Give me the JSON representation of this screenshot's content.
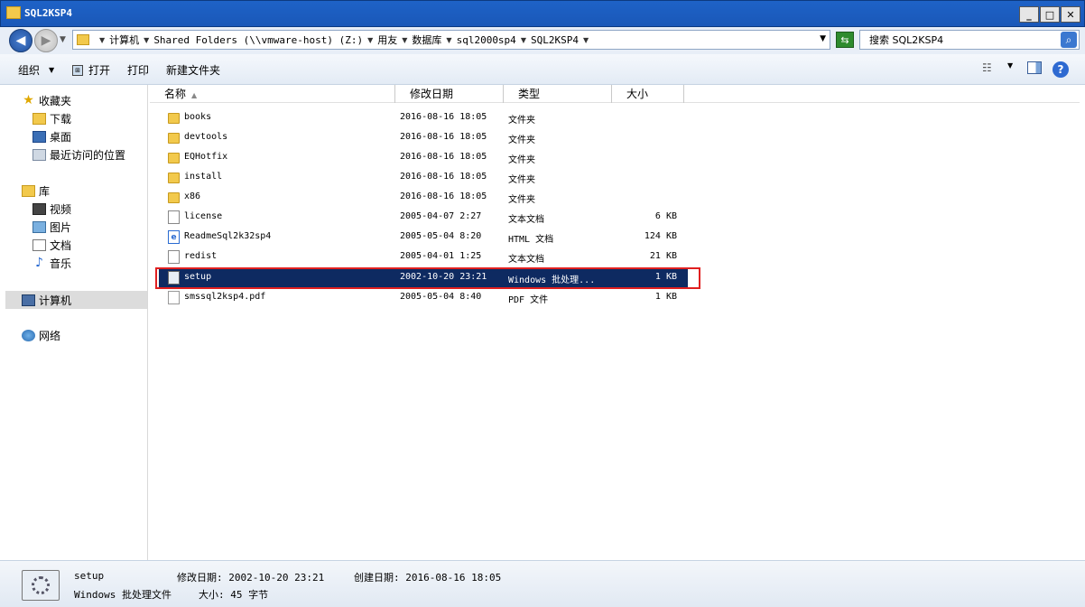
{
  "window": {
    "title": "SQL2KSP4"
  },
  "window_buttons": {
    "minimize": "_",
    "maximize": "□",
    "close": "✕"
  },
  "address": {
    "crumbs": [
      "计算机",
      "Shared Folders (\\\\vmware-host) (Z:)",
      "用友",
      "数据库",
      "sql2000sp4",
      "SQL2KSP4"
    ],
    "search_placeholder": "搜索 SQL2KSP4"
  },
  "toolbar": {
    "organize": "组织",
    "open": "打开",
    "print": "打印",
    "new_folder": "新建文件夹"
  },
  "nav": {
    "favorites": "收藏夹",
    "downloads": "下载",
    "desktop": "桌面",
    "recent": "最近访问的位置",
    "libraries": "库",
    "videos": "视频",
    "pictures": "图片",
    "documents": "文档",
    "music": "音乐",
    "computer": "计算机",
    "network": "网络"
  },
  "columns": {
    "name": "名称",
    "date": "修改日期",
    "type": "类型",
    "size": "大小"
  },
  "files": [
    {
      "name": "books",
      "date": "2016-08-16 18:05",
      "type": "文件夹",
      "size": "",
      "icon": "folder-icon"
    },
    {
      "name": "devtools",
      "date": "2016-08-16 18:05",
      "type": "文件夹",
      "size": "",
      "icon": "folder-icon"
    },
    {
      "name": "EQHotfix",
      "date": "2016-08-16 18:05",
      "type": "文件夹",
      "size": "",
      "icon": "folder-icon"
    },
    {
      "name": "install",
      "date": "2016-08-16 18:05",
      "type": "文件夹",
      "size": "",
      "icon": "folder-icon"
    },
    {
      "name": "x86",
      "date": "2016-08-16 18:05",
      "type": "文件夹",
      "size": "",
      "icon": "folder-icon"
    },
    {
      "name": "license",
      "date": "2005-04-07 2:27",
      "type": "文本文档",
      "size": "6 KB",
      "icon": "text-file-icon"
    },
    {
      "name": "ReadmeSql2k32sp4",
      "date": "2005-05-04 8:20",
      "type": "HTML 文档",
      "size": "124 KB",
      "icon": "html-file-icon"
    },
    {
      "name": "redist",
      "date": "2005-04-01 1:25",
      "type": "文本文档",
      "size": "21 KB",
      "icon": "text-file-icon"
    },
    {
      "name": "setup",
      "date": "2002-10-20 23:21",
      "type": "Windows 批处理...",
      "size": "1 KB",
      "icon": "batch-file-icon"
    },
    {
      "name": "smssql2ksp4.pdf",
      "date": "2005-05-04 8:40",
      "type": "PDF 文件",
      "size": "1 KB",
      "icon": "pdf-file-icon"
    }
  ],
  "details": {
    "name": "setup",
    "type": "Windows 批处理文件",
    "modified": "修改日期: 2002-10-20 23:21",
    "created": "创建日期: 2016-08-16 18:05",
    "size": "大小: 45 字节"
  }
}
